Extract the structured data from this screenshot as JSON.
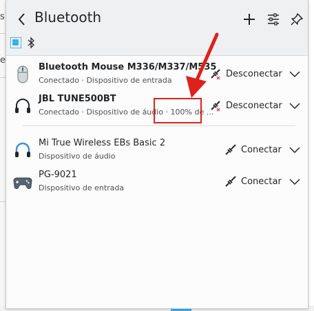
{
  "background": {
    "left_fragment_1": "s",
    "left_fragment_2": "e"
  },
  "header": {
    "title": "Bluetooth",
    "icons": {
      "back": "chevron-left-icon",
      "add": "plus-icon",
      "configure": "sliders-icon",
      "pin": "pin-icon"
    },
    "bluetooth_enabled": true,
    "toggle_icon": "bluetooth-icon"
  },
  "devices_connected": [
    {
      "name": "Bluetooth Mouse M336/M337/M535",
      "status": "Conectado · Dispositivo de entrada",
      "action": "Desconectar",
      "icon": "mouse-icon"
    },
    {
      "name": "JBL TUNE500BT",
      "status": "Conectado · Dispositivo de áudio · 100% de ...",
      "action": "Desconectar",
      "icon": "headphones-icon"
    }
  ],
  "devices_available": [
    {
      "name": "Mi True Wireless EBs Basic 2",
      "status": "Dispositivo de áudio",
      "action": "Conectar",
      "icon": "headphones-icon"
    },
    {
      "name": "PG-9021",
      "status": "Dispositivo de entrada",
      "action": "Conectar",
      "icon": "gamepad-icon"
    }
  ],
  "colors": {
    "accent": "#3daee9",
    "annotation": "#e0201b",
    "header_bg": "#eff0f1",
    "disconnect_x": "#da4453"
  }
}
